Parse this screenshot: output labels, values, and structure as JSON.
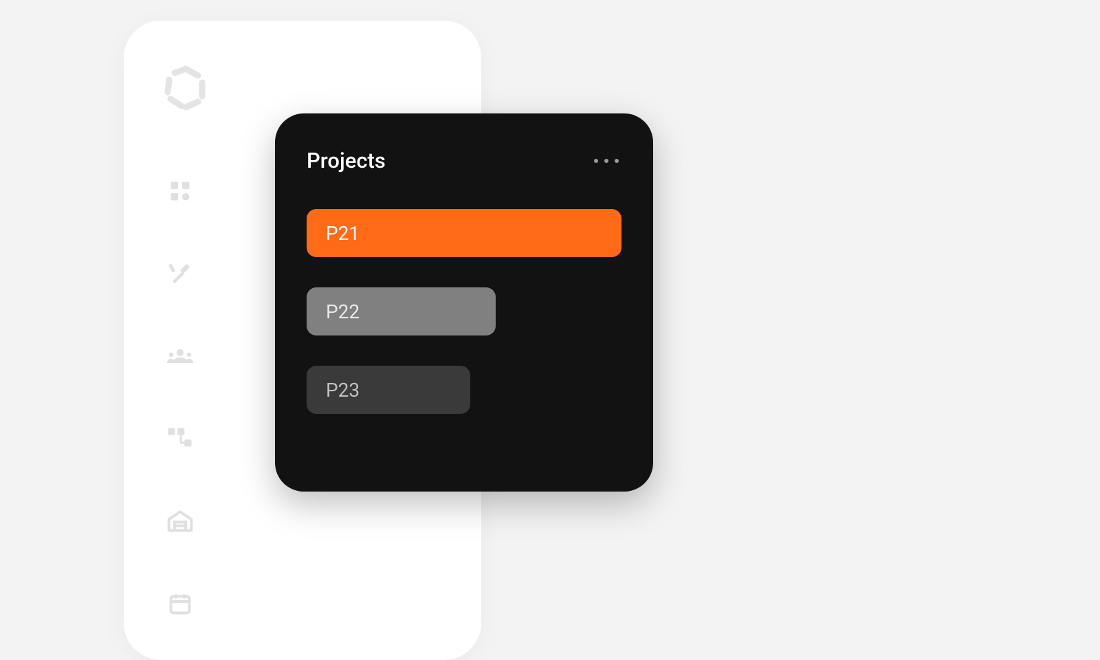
{
  "sidebar": {
    "nav_items": [
      {
        "name": "dashboard"
      },
      {
        "name": "tools"
      },
      {
        "name": "people"
      },
      {
        "name": "workflow"
      },
      {
        "name": "home"
      },
      {
        "name": "calendar"
      }
    ]
  },
  "projects_panel": {
    "title": "Projects",
    "items": [
      {
        "label": "P21",
        "state": "active"
      },
      {
        "label": "P22",
        "state": "mid"
      },
      {
        "label": "P23",
        "state": "dim"
      }
    ]
  },
  "colors": {
    "accent": "#ff6a17",
    "panel_bg": "#121212",
    "app_bg": "#f3f3f3",
    "sidebar_bg": "#ffffff"
  }
}
